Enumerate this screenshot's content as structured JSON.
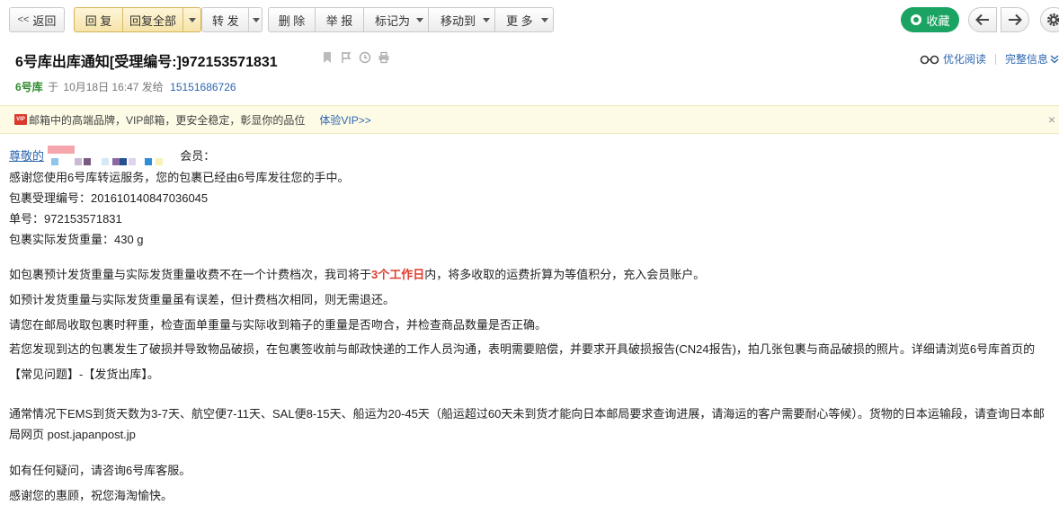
{
  "toolbar": {
    "back_label": "返回",
    "reply_label": "回 复",
    "reply_all_label": "回复全部",
    "forward_label": "转 发",
    "delete_label": "删 除",
    "report_label": "举 报",
    "mark_as_label": "标记为",
    "move_to_label": "移动到",
    "more_label": "更 多",
    "favorite_label": "收藏"
  },
  "header": {
    "subject": "6号库出库通知[受理编号:]972153571831",
    "sender": "6号库",
    "date_prefix": "于",
    "date": "10月18日 16:47",
    "sent_to_label": "发给",
    "recipient": "15151686726",
    "optimize_reading_label": "优化阅读",
    "full_info_label": "完整信息"
  },
  "banner": {
    "badge_text": "VIP",
    "text": "邮箱中的高端品牌，VIP邮箱，更安全稳定，彰显你的品位",
    "link": "体验VIP>>",
    "close": "×"
  },
  "body": {
    "greeting_prefix": "尊敬的",
    "greeting_suffix": "会员：",
    "line_thanks": "感谢您使用6号库转运服务，您的包裹已经由6号库发往您的手中。",
    "line_accept_no": "包裹受理编号：201610140847036045",
    "line_order_no": "单号：972153571831",
    "line_weight": "包裹实际发货重量：430 g",
    "para1_before": "如包裹预计发货重量与实际发货重量收费不在一个计费档次，我司将于",
    "para1_highlight": "3个工作日",
    "para1_after": "内，将多收取的运费折算为等值积分，充入会员账户。",
    "para2": "如预计发货重量与实际发货重量虽有误差，但计费档次相同，则无需退还。",
    "para3": "请您在邮局收取包裹时秤重，检查面单重量与实际收到箱子的重量是否吻合，并检查商品数量是否正确。",
    "para4": "若您发现到达的包裹发生了破损并导致物品破损，在包裹签收前与邮政快递的工作人员沟通，表明需要赔偿，并要求开具破损报告(CN24报告)，拍几张包裹与商品破损的照片。详细请浏览6号库首页的【常见问题】-【发货出库】。",
    "para5": "通常情况下EMS到货天数为3-7天、航空便7-11天、SAL便8-15天、船运为20-45天（船运超过60天未到货才能向日本邮局要求查询进展，请海运的客户需要耐心等候）。货物的日本运输段，请查询日本邮局网页 post.japanpost.jp",
    "para6": "如有任何疑问，请咨询6号库客服。",
    "para7": "感谢您的惠顾，祝您海淘愉快。"
  },
  "colors": {
    "favorite_green": "#1aa362",
    "sender_green": "#2e8b2e",
    "link_blue": "#2d66b0",
    "highlight_red": "#e03b2e",
    "banner_bg": "#fdfbe6"
  }
}
